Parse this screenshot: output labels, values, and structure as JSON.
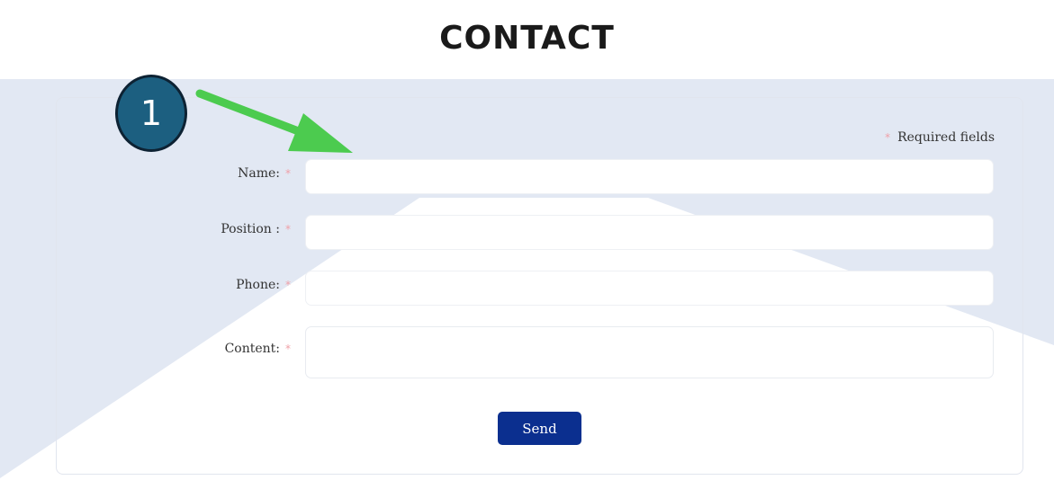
{
  "page": {
    "title": "CONTACT"
  },
  "annotation": {
    "step_number": "1",
    "arrow_color": "#4ccb4f",
    "badge_color": "#1c5f80"
  },
  "form": {
    "required_note": "Required fields",
    "required_marker": "*",
    "fields": {
      "name": {
        "label": "Name:",
        "value": "",
        "placeholder": ""
      },
      "position": {
        "label": "Position :",
        "value": "",
        "placeholder": ""
      },
      "phone": {
        "label": "Phone:",
        "value": "",
        "placeholder": ""
      },
      "content": {
        "label": "Content:",
        "value": "",
        "placeholder": ""
      }
    },
    "submit_label": "Send",
    "submit_color": "#0b2f8f",
    "background_color": "#e2e8f3"
  }
}
